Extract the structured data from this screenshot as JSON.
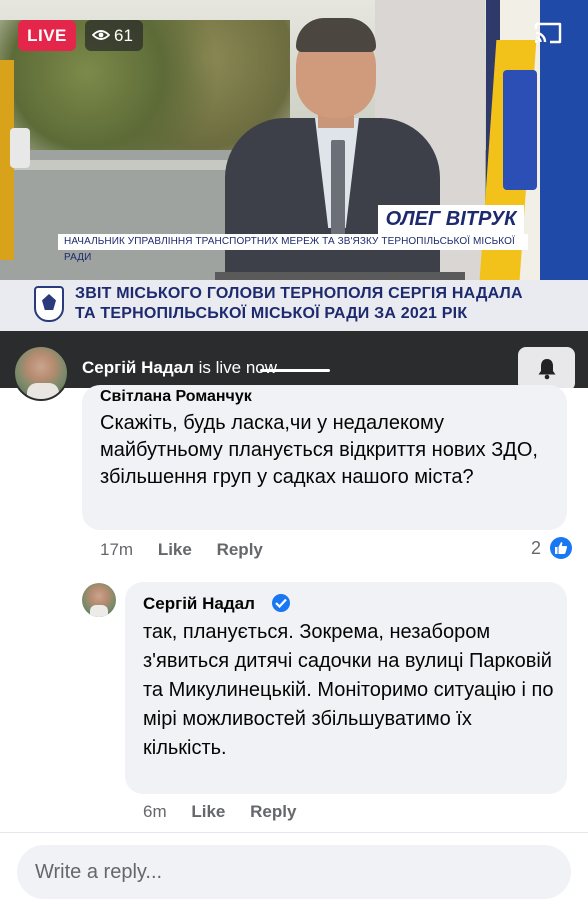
{
  "video": {
    "live_label": "LIVE",
    "viewer_count": "61",
    "speaker_name": "ОЛЕГ ВІТРУК",
    "speaker_role": "НАЧАЛЬНИК УПРАВЛІННЯ ТРАНСПОРТНИХ МЕРЕЖ ТА ЗВ'ЯЗКУ ТЕРНОПІЛЬСЬКОЇ МІСЬКОЇ РАДИ",
    "title_line1": "ЗВІТ МІСЬКОГО ГОЛОВИ ТЕРНОПОЛЯ СЕРГІЯ НАДАЛА",
    "title_line2": "ТА ТЕРНОПІЛЬСЬКОЇ МІСЬКОЇ РАДИ ЗА 2021 РІК"
  },
  "host": {
    "name": "Сергій Надал",
    "status": " is live now"
  },
  "comments": [
    {
      "author": "Світлана Романчук",
      "text": "Скажіть, будь ласка,чи у недалекому майбутньому планується відкриття нових ЗДО, збільшення груп у садках нашого міста?",
      "time": "17m",
      "like_label": "Like",
      "reply_label": "Reply",
      "reaction_count": "2"
    },
    {
      "author": "Сергій Надал",
      "verified": true,
      "text": "так, планується. Зокрема, незабором з'явиться дитячі садочки на вулиці Парковій та Микулинецькій. Моніторимо ситуацію і по мірі можливостей збільшуватимо їх кількість.",
      "time": "6m",
      "like_label": "Like",
      "reply_label": "Reply"
    }
  ],
  "reply_box": {
    "placeholder": "Write a reply..."
  },
  "colors": {
    "live_red": "#e3264a",
    "fb_blue": "#1877f2",
    "bubble_gray": "#f0f2f5",
    "meta_gray": "#65676b",
    "host_bar": "#2b2c2e"
  }
}
